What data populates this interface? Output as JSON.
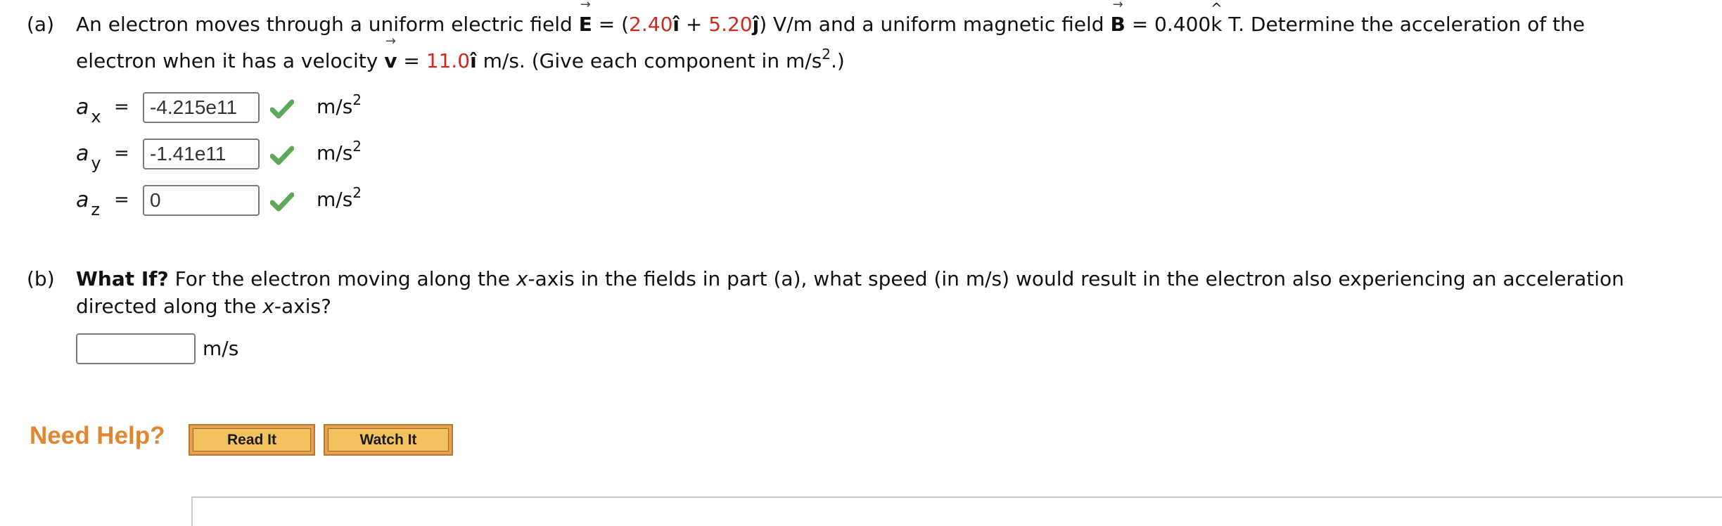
{
  "part_a": {
    "label": "(a)",
    "line1": {
      "t1": "An electron moves through a uniform electric field ",
      "E_symbol": "E",
      "t2": " = (",
      "Ex": "2.40",
      "i_hat": "î",
      "t3": " + ",
      "Ey": "5.20",
      "j_hat": "ĵ",
      "t4": ") V/m and a uniform magnetic field ",
      "B_symbol": "B",
      "t5": " = 0.400",
      "k_letter": "k",
      "t6": " T. Determine the acceleration of the"
    },
    "line2": {
      "t1": "electron when it has a velocity ",
      "v_symbol": "v",
      "t2": " = ",
      "vx": "11.0",
      "i_hat": "î",
      "t3": " m/s. (Give each component in m/s",
      "sup": "2",
      "t4": ".)"
    },
    "arrow_glyph": "→",
    "hat_glyph": "^",
    "answers": [
      {
        "var": "a",
        "sub": "x",
        "eq": "=",
        "value": "-4.215e11",
        "status": "correct",
        "unit": "m/s",
        "unit_sup": "2"
      },
      {
        "var": "a",
        "sub": "y",
        "eq": "=",
        "value": "-1.41e11",
        "status": "correct",
        "unit": "m/s",
        "unit_sup": "2"
      },
      {
        "var": "a",
        "sub": "z",
        "eq": "=",
        "value": "0",
        "status": "correct",
        "unit": "m/s",
        "unit_sup": "2"
      }
    ]
  },
  "part_b": {
    "label": "(b)",
    "bold_lead": "What If?",
    "line1_rest": " For the electron moving along the ",
    "x_var": "x",
    "line1_end": "-axis in the fields in part (a), what speed (in m/s) would result in the electron also experiencing an acceleration",
    "line2_start": "directed along the ",
    "line2_end": "-axis?",
    "answer_value": "",
    "unit": "m/s"
  },
  "help": {
    "label": "Need Help?",
    "read_it": "Read It",
    "watch_it": "Watch It"
  },
  "colors": {
    "given_value": "#cc2a1f",
    "check": "#5ea85a",
    "help_label": "#e08530"
  }
}
